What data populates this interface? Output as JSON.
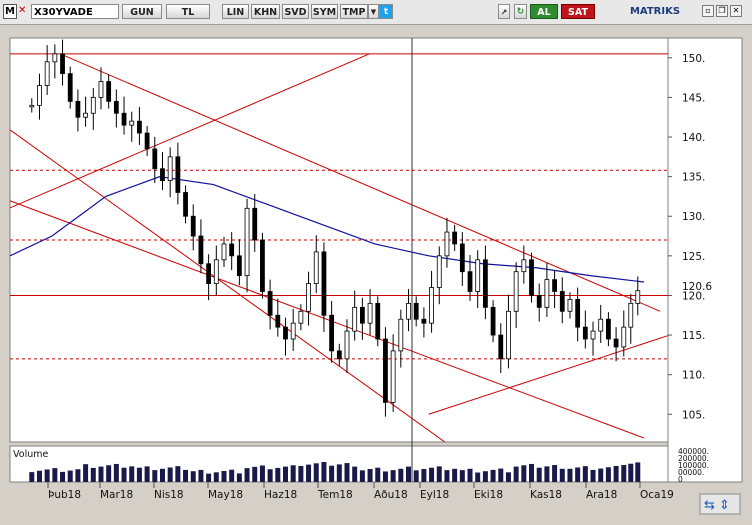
{
  "toolbar": {
    "logo": "M",
    "close": "✕",
    "symbol": "X30YVADE",
    "buttons": [
      "GUN",
      "TL",
      "LIN",
      "KHN",
      "SVD",
      "SYM",
      "TMP"
    ],
    "brand": "MATRIKS",
    "buy_label": "AL",
    "sell_label": "SAT",
    "icons": [
      "dropdown-icon",
      "twitter-icon",
      "pin-icon",
      "refresh-icon",
      "settings-icon",
      "tile-icon",
      "restore-icon",
      "close-icon"
    ]
  },
  "colors": {
    "candles": "#000000",
    "trendlines": "#cc0000",
    "moving_average": "#1010a0",
    "volume": "#1a1a4a",
    "plot_background": "#ffffff",
    "frame": "#d4d0c8"
  },
  "chart_data": {
    "type": "candlestick",
    "title": "",
    "xlabel": "",
    "ylabel": "",
    "ylim": [
      101.5,
      152.5
    ],
    "y_ticks": [
      "105.",
      "110.",
      "115.",
      "120.",
      "125.",
      "130.",
      "135.",
      "140.",
      "145.",
      "150."
    ],
    "last_price_label": "120.6",
    "x_ticks": [
      "Þub18",
      "Mar18",
      "Nis18",
      "May18",
      "Haz18",
      "Tem18",
      "Aðu18",
      "Eyl18",
      "Eki18",
      "Kas18",
      "Ara18",
      "Oca19"
    ],
    "volume_panel_label": "Volume",
    "volume_tick_labels": [
      "400000.",
      "200000.",
      "100000.",
      "00000.",
      "0"
    ],
    "horizontal_lines": [
      {
        "value": 150.5,
        "style": "solid"
      },
      {
        "value": 120.0,
        "style": "solid"
      },
      {
        "value": 135.8,
        "style": "dashed"
      },
      {
        "value": 127.0,
        "style": "dashed"
      },
      {
        "value": 112.0,
        "style": "dashed"
      }
    ],
    "cursor_date": "Aðu18",
    "approx_close_series": [
      {
        "month": "Þub18",
        "values": [
          144.0,
          146.5,
          149.5,
          150.5,
          148.0,
          144.5,
          142.5
        ]
      },
      {
        "month": "Mar18",
        "values": [
          143.0,
          145.0,
          147.0,
          144.5,
          143.0,
          141.5,
          142.0
        ]
      },
      {
        "month": "Nis18",
        "values": [
          140.5,
          138.5,
          136.0,
          134.5,
          137.5,
          133.0,
          130.0
        ]
      },
      {
        "month": "May18",
        "values": [
          127.5,
          124.0,
          121.5,
          124.5,
          126.5,
          125.0,
          122.5
        ]
      },
      {
        "month": "Haz18",
        "values": [
          131.0,
          127.0,
          120.5,
          117.5,
          116.0,
          114.5,
          116.5
        ]
      },
      {
        "month": "Tem18",
        "values": [
          118.0,
          121.5,
          125.5,
          117.5,
          113.0,
          112.0,
          115.5
        ]
      },
      {
        "month": "Aðu18",
        "values": [
          118.5,
          116.5,
          119.0,
          114.5,
          106.5,
          113.0,
          117.0
        ]
      },
      {
        "month": "Eyl18",
        "values": [
          119.0,
          117.0,
          116.5,
          121.0,
          125.0,
          128.0,
          126.5
        ]
      },
      {
        "month": "Eki18",
        "values": [
          123.0,
          120.5,
          124.5,
          118.5,
          115.0,
          112.0,
          118.0
        ]
      },
      {
        "month": "Kas18",
        "values": [
          123.0,
          124.5,
          120.0,
          118.5,
          122.0,
          120.5,
          118.0
        ]
      },
      {
        "month": "Ara18",
        "values": [
          119.5,
          116.0,
          114.5,
          115.5,
          117.0,
          114.5,
          113.5
        ]
      },
      {
        "month": "Oca19",
        "values": [
          116.0,
          119.0,
          120.6
        ]
      }
    ],
    "moving_average": [
      {
        "month": "Þub18",
        "value": 127.5
      },
      {
        "month": "Mar18",
        "value": 132.5
      },
      {
        "month": "Nis18",
        "value": 135.0
      },
      {
        "month": "May18",
        "value": 134.0
      },
      {
        "month": "Haz18",
        "value": 131.5
      },
      {
        "month": "Tem18",
        "value": 129.0
      },
      {
        "month": "Aðu18",
        "value": 126.5
      },
      {
        "month": "Eyl18",
        "value": 125.0
      },
      {
        "month": "Eki18",
        "value": 124.0
      },
      {
        "month": "Kas18",
        "value": 123.5
      },
      {
        "month": "Ara18",
        "value": 122.5
      },
      {
        "month": "Oca19",
        "value": 121.7
      }
    ],
    "trendlines": [
      {
        "from": {
          "month_index": 0.15,
          "value": 150.5
        },
        "to": {
          "month_index": 11.3,
          "value": 118.0
        }
      },
      {
        "from": {
          "month_index": -0.8,
          "value": 141.0
        },
        "to": {
          "month_index": 7.3,
          "value": 101.5
        }
      },
      {
        "from": {
          "month_index": -0.8,
          "value": 132.0
        },
        "to": {
          "month_index": 11.0,
          "value": 102.0
        }
      },
      {
        "from": {
          "month_index": -0.8,
          "value": 131.0
        },
        "to": {
          "month_index": 5.9,
          "value": 150.5
        }
      },
      {
        "from": {
          "month_index": 7.0,
          "value": 105.0
        },
        "to": {
          "month_index": 11.7,
          "value": 115.5
        }
      }
    ],
    "volume": [
      55,
      72,
      60,
      48,
      66,
      80,
      58,
      62,
      50,
      70,
      64,
      85
    ]
  }
}
